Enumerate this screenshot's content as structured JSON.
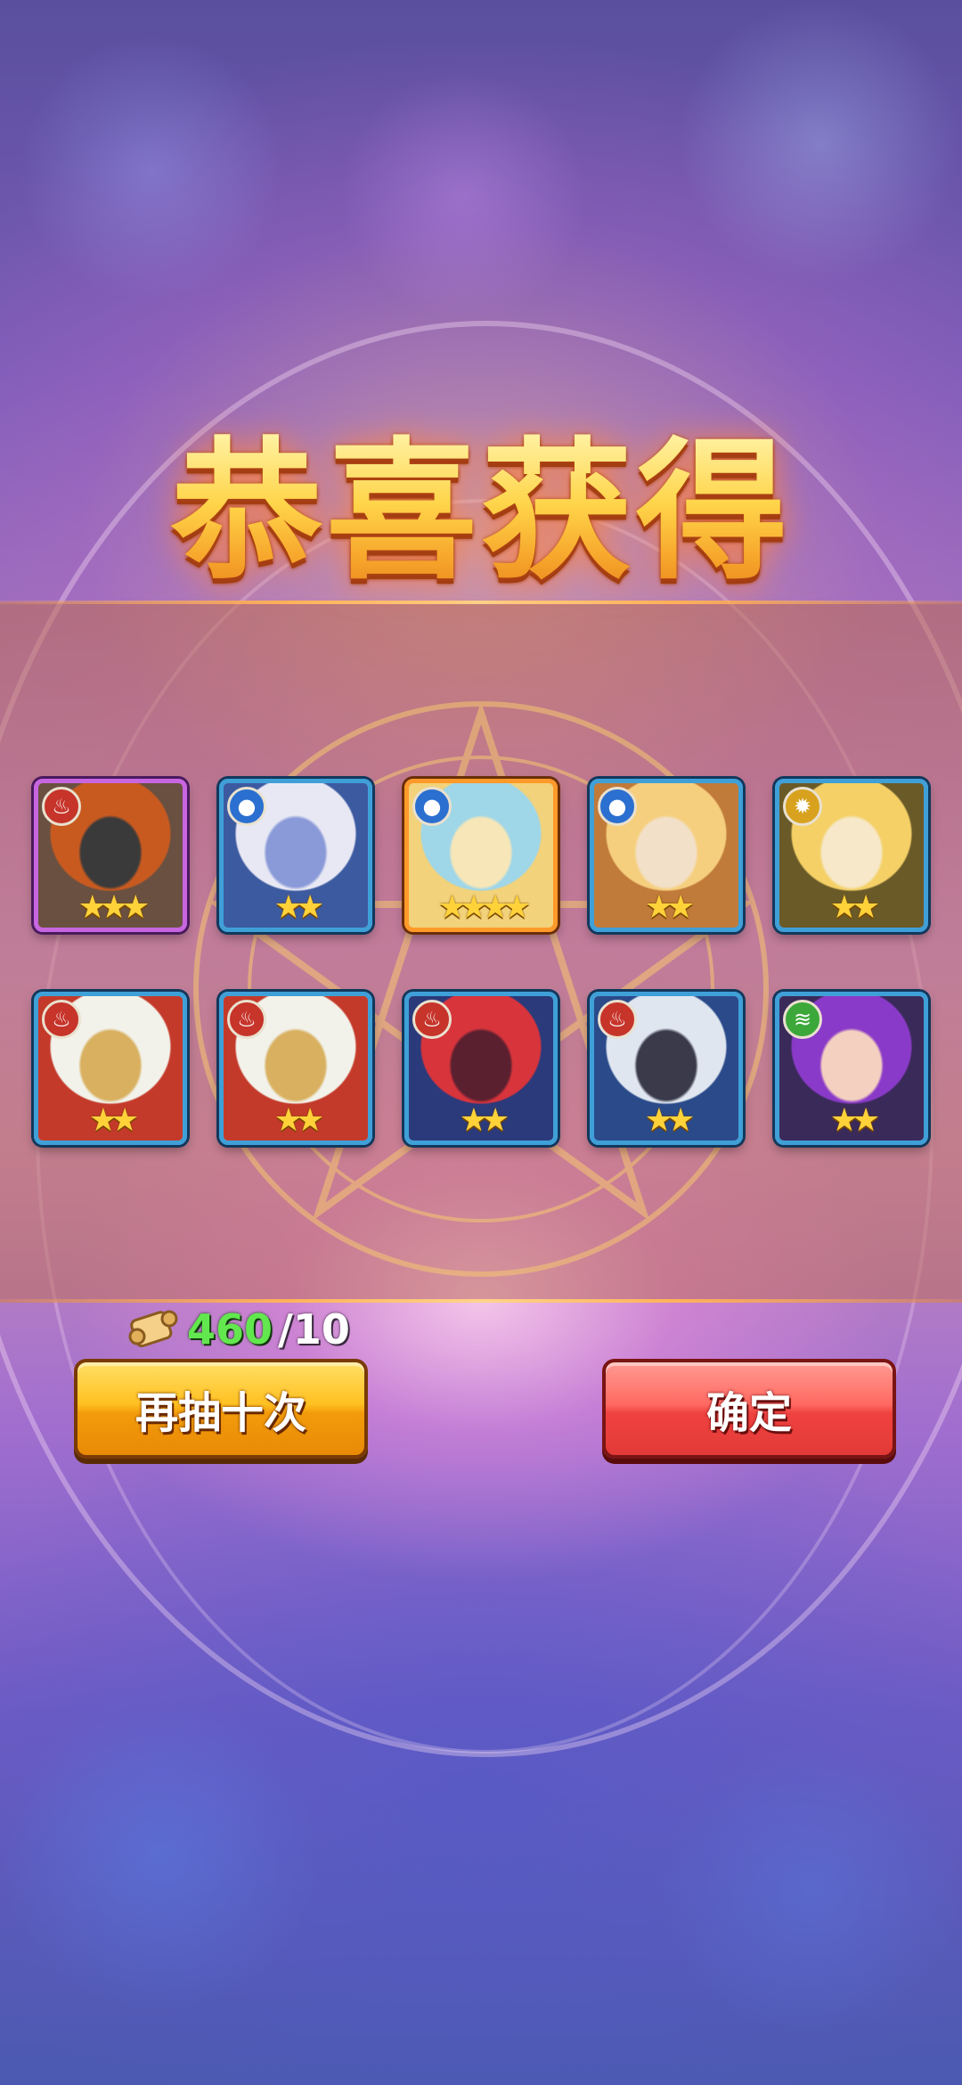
{
  "title": "恭喜获得",
  "cards": [
    {
      "name": "dwarf-warrior",
      "element": "fire",
      "stars": 3,
      "frame": "purple",
      "palette": [
        "#6a5040",
        "#c85a20",
        "#3a3a3a"
      ]
    },
    {
      "name": "silver-hair-girl",
      "element": "water",
      "stars": 2,
      "frame": "blue",
      "palette": [
        "#3c5aa0",
        "#e8e8f4",
        "#8a9ad8"
      ]
    },
    {
      "name": "golden-mermaid",
      "element": "water",
      "stars": 4,
      "frame": "orange",
      "palette": [
        "#f2d27a",
        "#9fd6e8",
        "#f6e6b8"
      ]
    },
    {
      "name": "blonde-girl",
      "element": "water",
      "stars": 2,
      "frame": "blue",
      "palette": [
        "#c07a3a",
        "#f6cf7e",
        "#f2e0c8"
      ]
    },
    {
      "name": "light-priestess",
      "element": "light",
      "stars": 2,
      "frame": "blue",
      "palette": [
        "#6a5a28",
        "#f4d066",
        "#f6e8c8"
      ]
    },
    {
      "name": "old-sage-1",
      "element": "fire",
      "stars": 2,
      "frame": "blue",
      "palette": [
        "#c43a2a",
        "#f2f2ea",
        "#d8b060"
      ]
    },
    {
      "name": "old-sage-2",
      "element": "fire",
      "stars": 2,
      "frame": "blue",
      "palette": [
        "#c43a2a",
        "#f2f2ea",
        "#d8b060"
      ]
    },
    {
      "name": "red-demon",
      "element": "fire",
      "stars": 2,
      "frame": "blue",
      "palette": [
        "#2a3a7a",
        "#d8343c",
        "#5a2030"
      ]
    },
    {
      "name": "werewolf",
      "element": "fire",
      "stars": 2,
      "frame": "blue",
      "palette": [
        "#2a4a8a",
        "#dfe6f0",
        "#3a3a4a"
      ]
    },
    {
      "name": "purple-hair-girl",
      "element": "wind",
      "stars": 2,
      "frame": "blue",
      "palette": [
        "#3a2a5a",
        "#8a3ac8",
        "#f4d0c0"
      ]
    }
  ],
  "cost": {
    "current": "460",
    "total": "/10",
    "icon": "scroll-icon"
  },
  "buttons": {
    "again_label": "再抽十次",
    "ok_label": "确定"
  },
  "element_colors": {
    "fire": "#c6342a",
    "water": "#2b6fd0",
    "light": "#d8a21e",
    "wind": "#3ca83a"
  }
}
